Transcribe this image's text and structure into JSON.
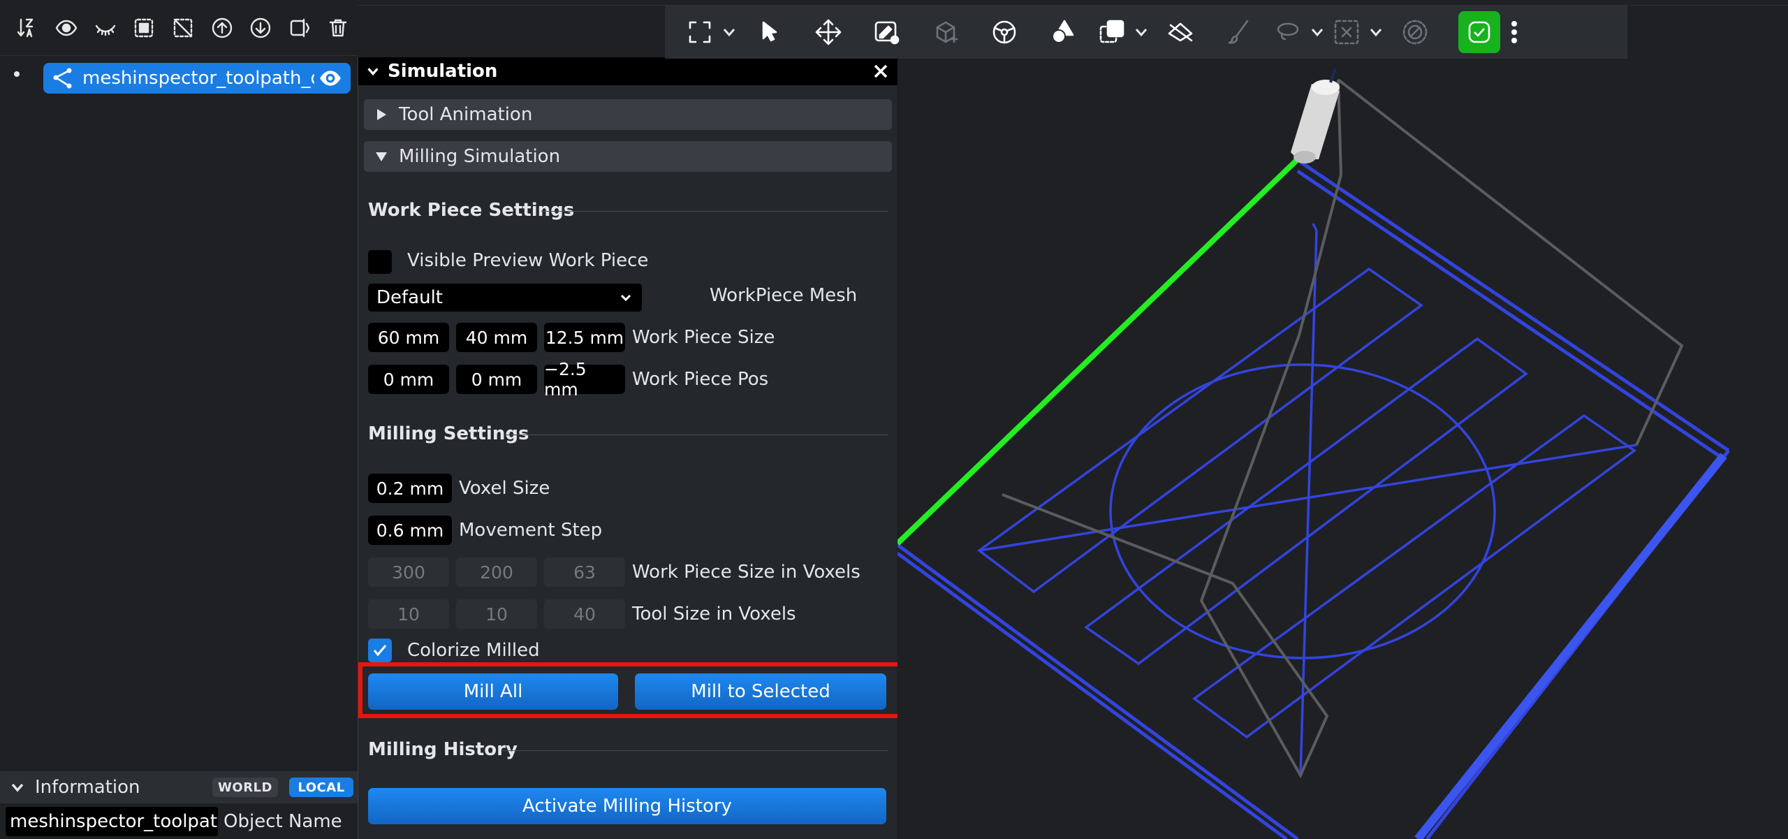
{
  "left_toolbar": {
    "icons": [
      "sort-az-icon",
      "show-icon",
      "hide-icon",
      "select-all-icon",
      "deselect-icon",
      "move-up-icon",
      "move-down-icon",
      "toggle-panel-icon",
      "delete-icon"
    ]
  },
  "scene_tree": {
    "item_label": "meshinspector_toolpath_de",
    "item_icon": "toolpath-icon"
  },
  "information": {
    "title": "Information",
    "world_label": "WORLD",
    "local_label": "LOCAL",
    "object_name_value": "meshinspector_toolpath_",
    "object_name_label": "Object Name"
  },
  "simulation": {
    "title": "Simulation",
    "tool_animation_label": "Tool Animation",
    "milling_simulation_label": "Milling Simulation",
    "work_piece_settings": {
      "title": "Work Piece Settings",
      "visible_preview_label": "Visible Preview Work Piece",
      "visible_preview_checked": false,
      "mesh_value": "Default",
      "mesh_label": "WorkPiece Mesh",
      "size_values": [
        "60 mm",
        "40 mm",
        "12.5 mm"
      ],
      "size_label": "Work Piece Size",
      "pos_values": [
        "0 mm",
        "0 mm",
        "−2.5 mm"
      ],
      "pos_label": "Work Piece Pos"
    },
    "milling_settings": {
      "title": "Milling Settings",
      "voxel_size_value": "0.2 mm",
      "voxel_size_label": "Voxel Size",
      "movement_step_value": "0.6 mm",
      "movement_step_label": "Movement Step",
      "size_in_voxels_values": [
        "300",
        "200",
        "63"
      ],
      "size_in_voxels_label": "Work Piece Size in Voxels",
      "tool_size_values": [
        "10",
        "10",
        "40"
      ],
      "tool_size_label": "Tool Size in Voxels",
      "colorize_label": "Colorize Milled",
      "colorize_checked": true,
      "mill_all_label": "Mill All",
      "mill_to_selected_label": "Mill to Selected"
    },
    "milling_history": {
      "title": "Milling History",
      "activate_label": "Activate Milling History"
    }
  },
  "main_toolbar": {
    "icons": [
      "fit-view-icon",
      "select-pointer-icon",
      "move-icon",
      "edit-object-icon",
      "spin-icon",
      "steering-wheel-icon",
      "shapes-icon",
      "duplicate-icon",
      "slice-icon",
      "brush-icon",
      "lasso-icon",
      "deselect-box-icon",
      "disable-icon",
      "accept-icon",
      "more-icon"
    ]
  },
  "colors": {
    "accent_blue": "#1a7de3",
    "highlight_red": "#e8150c",
    "toolpath_green": "#22ee22",
    "toolpath_blue": "#3344dd",
    "accept_green": "#17b21d"
  }
}
